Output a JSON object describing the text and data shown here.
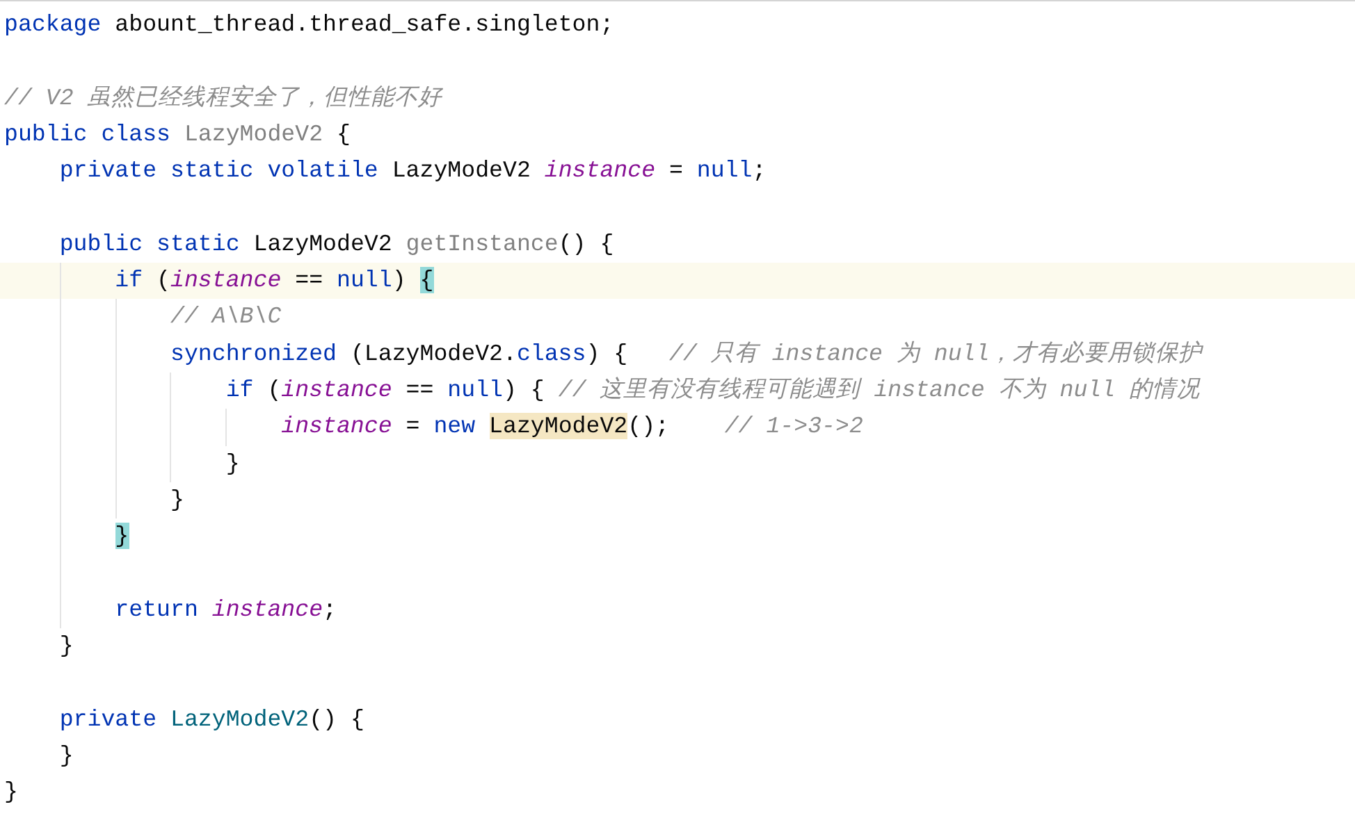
{
  "editor": {
    "lines": [
      {
        "current": false,
        "tokens": [
          {
            "kind": "keyword",
            "text": "package"
          },
          {
            "kind": "plain",
            "text": " abount_thread.thread_safe.singleton;"
          }
        ]
      },
      {
        "current": false
      },
      {
        "current": false,
        "tokens": [
          {
            "kind": "comment",
            "text": "// V2 虽然已经线程安全了，但性能不好"
          }
        ]
      },
      {
        "current": false,
        "tokens": [
          {
            "kind": "keyword",
            "text": "public class "
          },
          {
            "kind": "unused",
            "text": "LazyModeV2"
          },
          {
            "kind": "plain",
            "text": " {"
          }
        ],
        "children": [
          {
            "current": false,
            "tokens": [
              {
                "kind": "keyword",
                "text": "private static volatile "
              },
              {
                "kind": "plain",
                "text": "LazyModeV2 "
              },
              {
                "kind": "field",
                "text": "instance"
              },
              {
                "kind": "plain",
                "text": " = "
              },
              {
                "kind": "keyword",
                "text": "null"
              },
              {
                "kind": "plain",
                "text": ";"
              }
            ]
          },
          {
            "current": false
          },
          {
            "current": false,
            "tokens": [
              {
                "kind": "keyword",
                "text": "public static "
              },
              {
                "kind": "plain",
                "text": "LazyModeV2 "
              },
              {
                "kind": "unused",
                "text": "getInstance"
              },
              {
                "kind": "plain",
                "text": "() {"
              }
            ],
            "children": [
              {
                "current": true,
                "tokens": [
                  {
                    "kind": "keyword",
                    "text": "if"
                  },
                  {
                    "kind": "plain",
                    "text": " ("
                  },
                  {
                    "kind": "field",
                    "text": "instance"
                  },
                  {
                    "kind": "plain",
                    "text": " == "
                  },
                  {
                    "kind": "keyword",
                    "text": "null"
                  },
                  {
                    "kind": "plain",
                    "text": ") "
                  },
                  {
                    "kind": "brace-match",
                    "text": "{"
                  }
                ],
                "children": [
                  {
                    "current": false,
                    "tokens": [
                      {
                        "kind": "comment",
                        "text": "// A\\B\\C"
                      }
                    ]
                  },
                  {
                    "current": false,
                    "tokens": [
                      {
                        "kind": "keyword",
                        "text": "synchronized"
                      },
                      {
                        "kind": "plain",
                        "text": " (LazyModeV2."
                      },
                      {
                        "kind": "keyword",
                        "text": "class"
                      },
                      {
                        "kind": "plain",
                        "text": ") {   "
                      },
                      {
                        "kind": "comment",
                        "text": "// 只有 instance 为 null，才有必要用锁保护"
                      }
                    ],
                    "children": [
                      {
                        "current": false,
                        "tokens": [
                          {
                            "kind": "keyword",
                            "text": "if"
                          },
                          {
                            "kind": "plain",
                            "text": " ("
                          },
                          {
                            "kind": "field",
                            "text": "instance"
                          },
                          {
                            "kind": "plain",
                            "text": " == "
                          },
                          {
                            "kind": "keyword",
                            "text": "null"
                          },
                          {
                            "kind": "plain",
                            "text": ") { "
                          },
                          {
                            "kind": "comment",
                            "text": "// 这里有没有线程可能遇到 instance 不为 null 的情况"
                          }
                        ],
                        "children": [
                          {
                            "current": false,
                            "tokens": [
                              {
                                "kind": "field",
                                "text": "instance"
                              },
                              {
                                "kind": "plain",
                                "text": " = "
                              },
                              {
                                "kind": "keyword",
                                "text": "new "
                              },
                              {
                                "kind": "usage",
                                "text": "LazyModeV2"
                              },
                              {
                                "kind": "plain",
                                "text": "();    "
                              },
                              {
                                "kind": "comment",
                                "text": "// 1->3->2"
                              }
                            ]
                          }
                        ]
                      },
                      {
                        "current": false,
                        "tokens": [
                          {
                            "kind": "plain",
                            "text": "}"
                          }
                        ]
                      }
                    ]
                  },
                  {
                    "current": false,
                    "tokens": [
                      {
                        "kind": "plain",
                        "text": "}"
                      }
                    ]
                  }
                ]
              },
              {
                "current": false,
                "tokens": [
                  {
                    "kind": "brace-match",
                    "text": "}"
                  }
                ]
              },
              {
                "current": false
              },
              {
                "current": false,
                "tokens": [
                  {
                    "kind": "keyword",
                    "text": "return "
                  },
                  {
                    "kind": "field",
                    "text": "instance"
                  },
                  {
                    "kind": "plain",
                    "text": ";"
                  }
                ]
              }
            ]
          },
          {
            "current": false,
            "tokens": [
              {
                "kind": "plain",
                "text": "}"
              }
            ]
          },
          {
            "current": false
          },
          {
            "current": false,
            "tokens": [
              {
                "kind": "keyword",
                "text": "private "
              },
              {
                "kind": "ctor",
                "text": "LazyModeV2"
              },
              {
                "kind": "plain",
                "text": "() {"
              }
            ]
          },
          {
            "current": false,
            "tokens": [
              {
                "kind": "plain",
                "text": "}"
              }
            ]
          }
        ]
      },
      {
        "current": false,
        "tokens": [
          {
            "kind": "plain",
            "text": "}"
          }
        ]
      }
    ]
  }
}
